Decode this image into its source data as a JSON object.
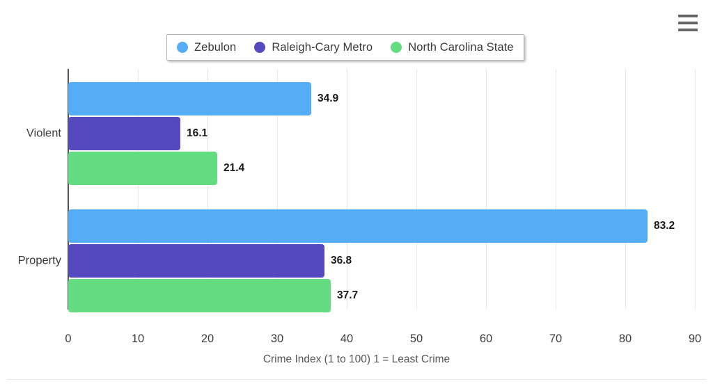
{
  "toolbar": {
    "menu_label": "Chart context menu",
    "menu_icon": "hamburger-menu-icon"
  },
  "chart_data": {
    "type": "bar",
    "orientation": "horizontal",
    "title": "",
    "subtitle": "",
    "xlabel": "Crime Index (1 to 100) 1 = Least Crime",
    "ylabel": "",
    "categories": [
      "Violent",
      "Property"
    ],
    "series": [
      {
        "name": "Zebulon",
        "color": "#55aef5",
        "values": [
          34.9,
          83.2
        ]
      },
      {
        "name": "Raleigh-Cary Metro",
        "color": "#5449be",
        "values": [
          16.1,
          36.8
        ]
      },
      {
        "name": "North Carolina State",
        "color": "#64dc82",
        "values": [
          21.4,
          37.7
        ]
      }
    ],
    "data_labels": [
      [
        "34.9",
        "16.1",
        "21.4"
      ],
      [
        "83.2",
        "36.8",
        "37.7"
      ]
    ],
    "xlim": [
      0,
      90
    ],
    "xticks": [
      0,
      10,
      20,
      30,
      40,
      50,
      60,
      70,
      80,
      90
    ],
    "xtick_labels": [
      "0",
      "10",
      "20",
      "30",
      "40",
      "50",
      "60",
      "70",
      "80",
      "90"
    ],
    "grid": true,
    "grid_axis": "x",
    "grid_color": "#e8e8e8",
    "legend_position": "top-center",
    "legend_entries": [
      "Zebulon",
      "Raleigh-Cary Metro",
      "North Carolina State"
    ]
  }
}
